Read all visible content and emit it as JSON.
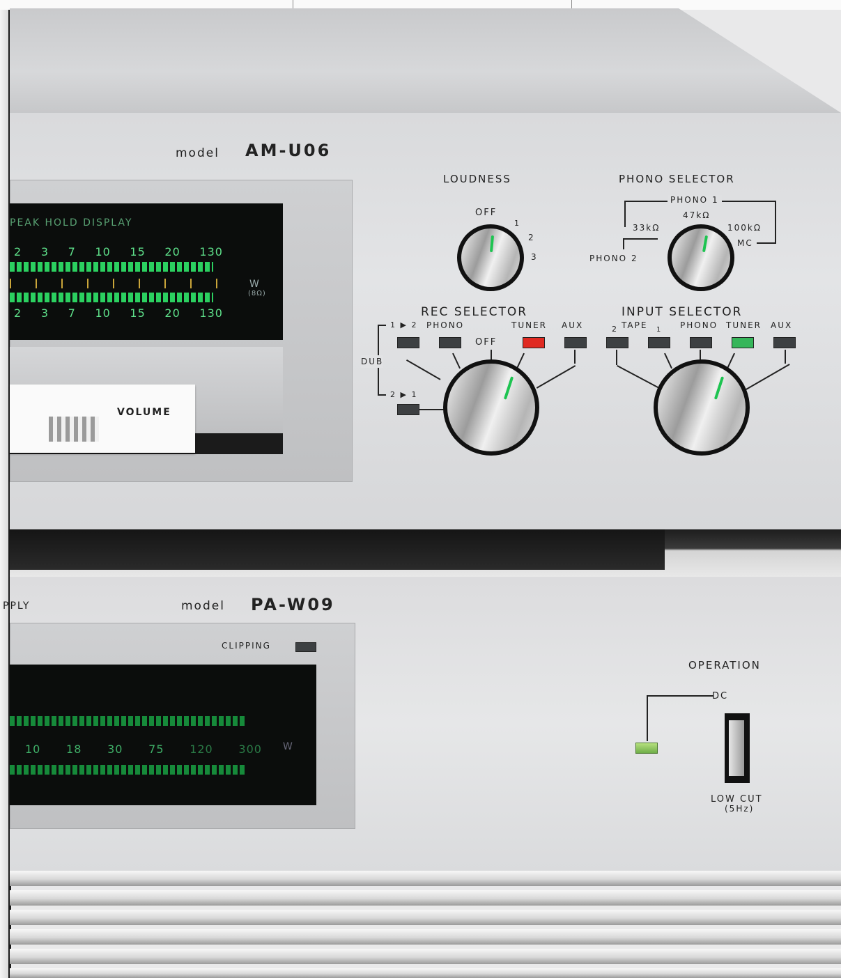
{
  "pre_amp": {
    "model_prefix": "model",
    "model_name": "AM-U06",
    "meter": {
      "title": "PEAK HOLD DISPLAY",
      "scale_top": [
        "2",
        "3",
        "7",
        "10",
        "15",
        "20",
        "130"
      ],
      "scale_bottom": [
        "2",
        "3",
        "7",
        "10",
        "15",
        "20",
        "130"
      ],
      "unit": "W",
      "unit_sub": "(8Ω)"
    },
    "volume_label": "VOLUME",
    "loudness": {
      "title": "LOUDNESS",
      "positions": [
        "OFF",
        "1",
        "2",
        "3"
      ]
    },
    "phono_selector": {
      "title": "PHONO SELECTOR",
      "phono1": "PHONO 1",
      "r47": "47kΩ",
      "r33": "33kΩ",
      "r100": "100kΩ",
      "mc": "MC",
      "phono2": "PHONO 2"
    },
    "rec_selector": {
      "title": "REC SELECTOR",
      "dub": "DUB",
      "one_to_two": "1 ▶ 2",
      "two_to_one": "2 ▶ 1",
      "phono": "PHONO",
      "off": "OFF",
      "tuner": "TUNER",
      "aux": "AUX",
      "active_color": "#e02a22"
    },
    "input_selector": {
      "title": "INPUT SELECTOR",
      "tape": "TAPE",
      "tape_2": "2",
      "tape_1": "1",
      "phono": "PHONO",
      "tuner": "TUNER",
      "aux": "AUX",
      "active_color": "#36b65a"
    }
  },
  "power_amp": {
    "side_fragment": "PPLY",
    "model_prefix": "model",
    "model_name": "PA-W09",
    "clipping": "CLIPPING",
    "meter": {
      "scale": [
        "10",
        "18",
        "30",
        "75",
        "120",
        "300"
      ],
      "unit": "W"
    },
    "operation": {
      "title": "OPERATION",
      "dc": "DC",
      "low_cut": "LOW CUT",
      "low_cut_sub": "(5Hz)"
    }
  }
}
